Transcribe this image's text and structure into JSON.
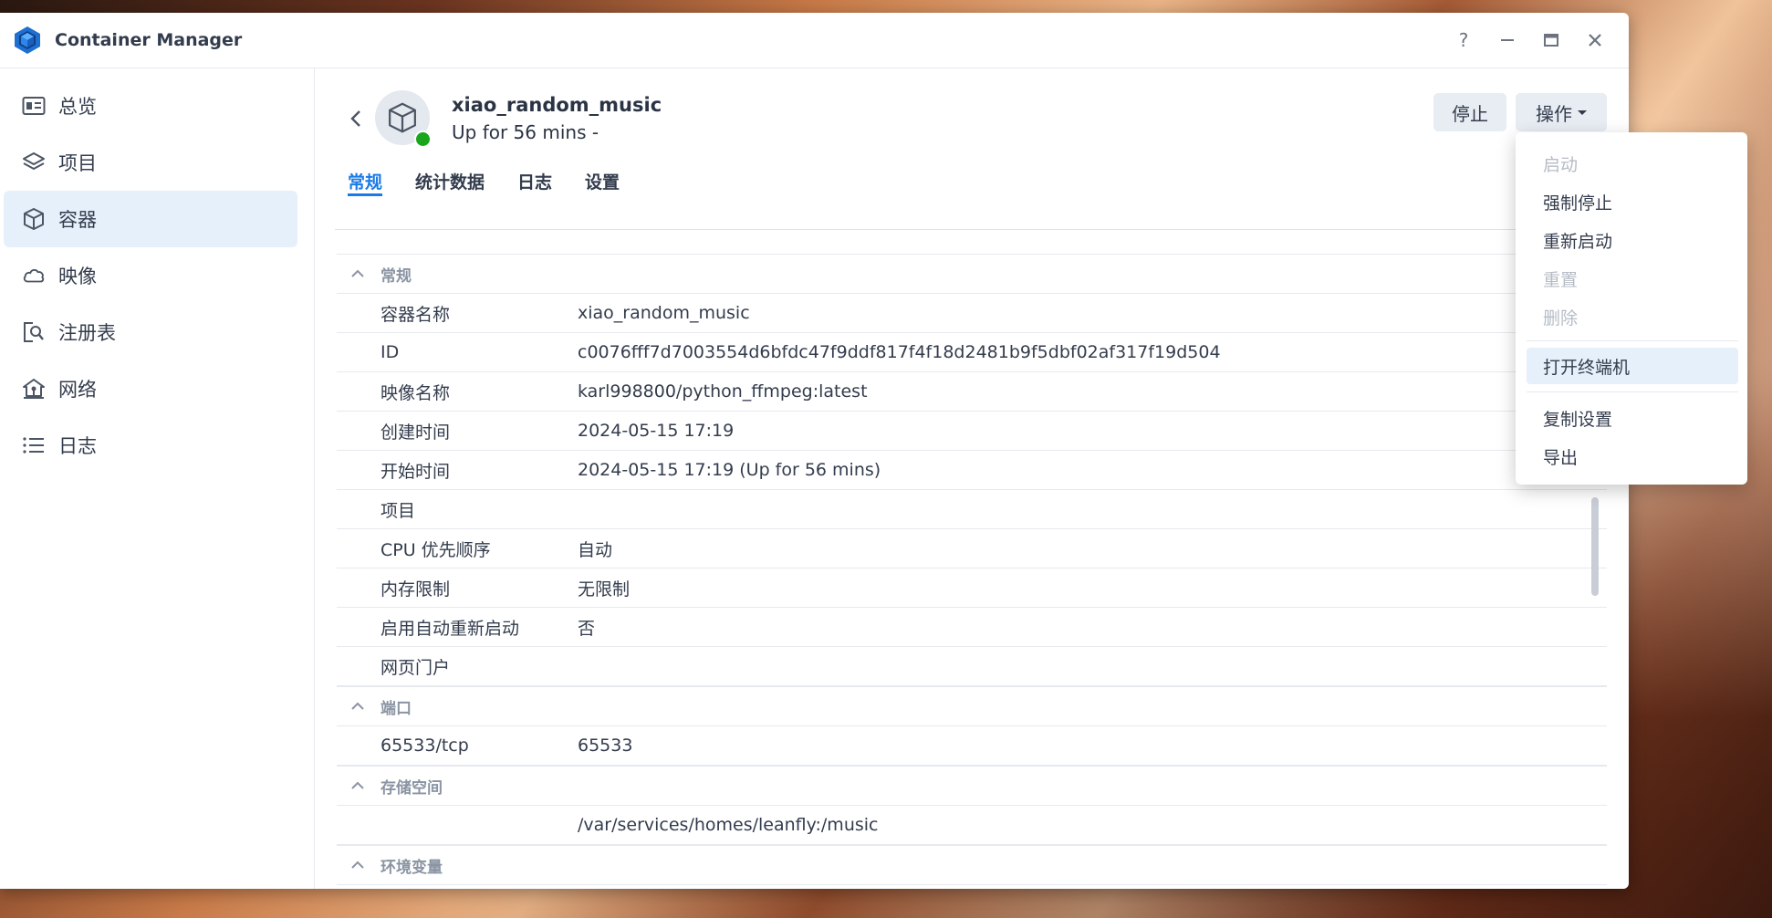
{
  "app": {
    "title": "Container Manager"
  },
  "window_controls": {
    "help": "?",
    "minimize": "—",
    "maximize": "▭",
    "close": "✕"
  },
  "sidebar": {
    "items": [
      {
        "label": "总览",
        "icon": "overview-icon"
      },
      {
        "label": "项目",
        "icon": "layers-icon"
      },
      {
        "label": "容器",
        "icon": "cube-icon",
        "active": true
      },
      {
        "label": "映像",
        "icon": "cloud-icon"
      },
      {
        "label": "注册表",
        "icon": "registry-search-icon"
      },
      {
        "label": "网络",
        "icon": "network-home-icon"
      },
      {
        "label": "日志",
        "icon": "list-icon"
      }
    ]
  },
  "container": {
    "name": "xiao_random_music",
    "status": "Up for 56 mins -",
    "status_color": "#19a51c"
  },
  "buttons": {
    "stop": "停止",
    "action": "操作"
  },
  "tabs": [
    {
      "label": "常规",
      "active": true
    },
    {
      "label": "统计数据"
    },
    {
      "label": "日志"
    },
    {
      "label": "设置"
    }
  ],
  "sections": {
    "general": {
      "title": "常规",
      "rows": [
        {
          "key": "容器名称",
          "value": "xiao_random_music"
        },
        {
          "key": "ID",
          "value": "c0076fff7d7003554d6bfdc47f9ddf817f4f18d2481b9f5dbf02af317f19d504"
        },
        {
          "key": "映像名称",
          "value": "karl998800/python_ffmpeg:latest"
        },
        {
          "key": "创建时间",
          "value": "2024-05-15 17:19"
        },
        {
          "key": "开始时间",
          "value": "2024-05-15 17:19 (Up for 56 mins)"
        },
        {
          "key": "项目",
          "value": ""
        },
        {
          "key": "CPU 优先顺序",
          "value": "自动"
        },
        {
          "key": "内存限制",
          "value": "无限制"
        },
        {
          "key": "启用自动重新启动",
          "value": "否"
        },
        {
          "key": "网页门户",
          "value": ""
        }
      ]
    },
    "ports": {
      "title": "端口",
      "rows": [
        {
          "key": "65533/tcp",
          "value": "65533"
        }
      ]
    },
    "storage": {
      "title": "存储空间",
      "rows": [
        {
          "key": "",
          "value": "/var/services/homes/leanfly:/music"
        }
      ]
    },
    "env": {
      "title": "环境变量"
    }
  },
  "dropdown": {
    "items": [
      {
        "label": "启动",
        "disabled": true
      },
      {
        "label": "强制停止"
      },
      {
        "label": "重新启动"
      },
      {
        "label": "重置",
        "disabled": true
      },
      {
        "label": "删除",
        "disabled": true
      },
      {
        "label": "打开终端机",
        "highlighted": true
      },
      {
        "label": "复制设置"
      },
      {
        "label": "导出"
      }
    ]
  },
  "colors": {
    "accent": "#1a7be6",
    "active_bg": "#e6f0fb"
  }
}
